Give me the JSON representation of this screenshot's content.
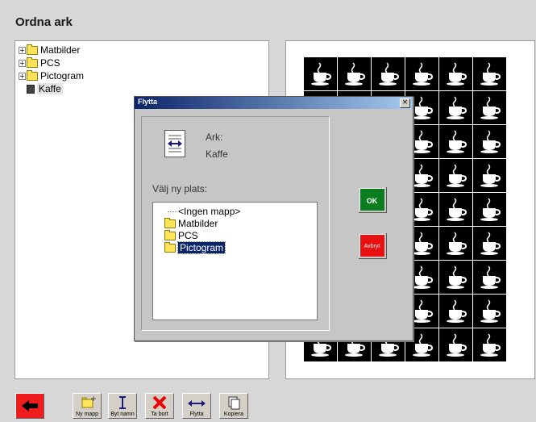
{
  "app": {
    "title": "Ordna ark"
  },
  "tree": {
    "items": [
      {
        "label": "Matbilder",
        "icon": "folder-icon",
        "expander": "+"
      },
      {
        "label": "PCS",
        "icon": "folder-icon",
        "expander": "+"
      },
      {
        "label": "Pictogram",
        "icon": "folder-icon",
        "expander": "+"
      },
      {
        "label": "Kaffe",
        "icon": "sheet-icon",
        "selected": true
      }
    ]
  },
  "preview": {
    "tile_icon": "coffee-cup-icon",
    "rows": 9,
    "cols": 6
  },
  "dialog": {
    "title": "Flytta",
    "close_label": "×",
    "sheet_type_label": "Ark:",
    "sheet_name": "Kaffe",
    "prompt": "Välj ny plats:",
    "locations": [
      {
        "label": "<Ingen mapp>"
      },
      {
        "label": "Matbilder"
      },
      {
        "label": "PCS"
      },
      {
        "label": "Pictogram",
        "selected": true
      }
    ],
    "ok_label": "OK",
    "cancel_label": "Avbryt"
  },
  "toolbar": {
    "new_folder_label": "Ny mapp",
    "rename_label": "Byt namn",
    "delete_label": "Ta bort",
    "move_label": "Flytta",
    "copy_label": "Kopiera"
  },
  "colors": {
    "back_button": "#ee1c1c",
    "ok_button": "#0a7e1e",
    "cancel_button": "#e81010",
    "selection": "#0a246a"
  }
}
